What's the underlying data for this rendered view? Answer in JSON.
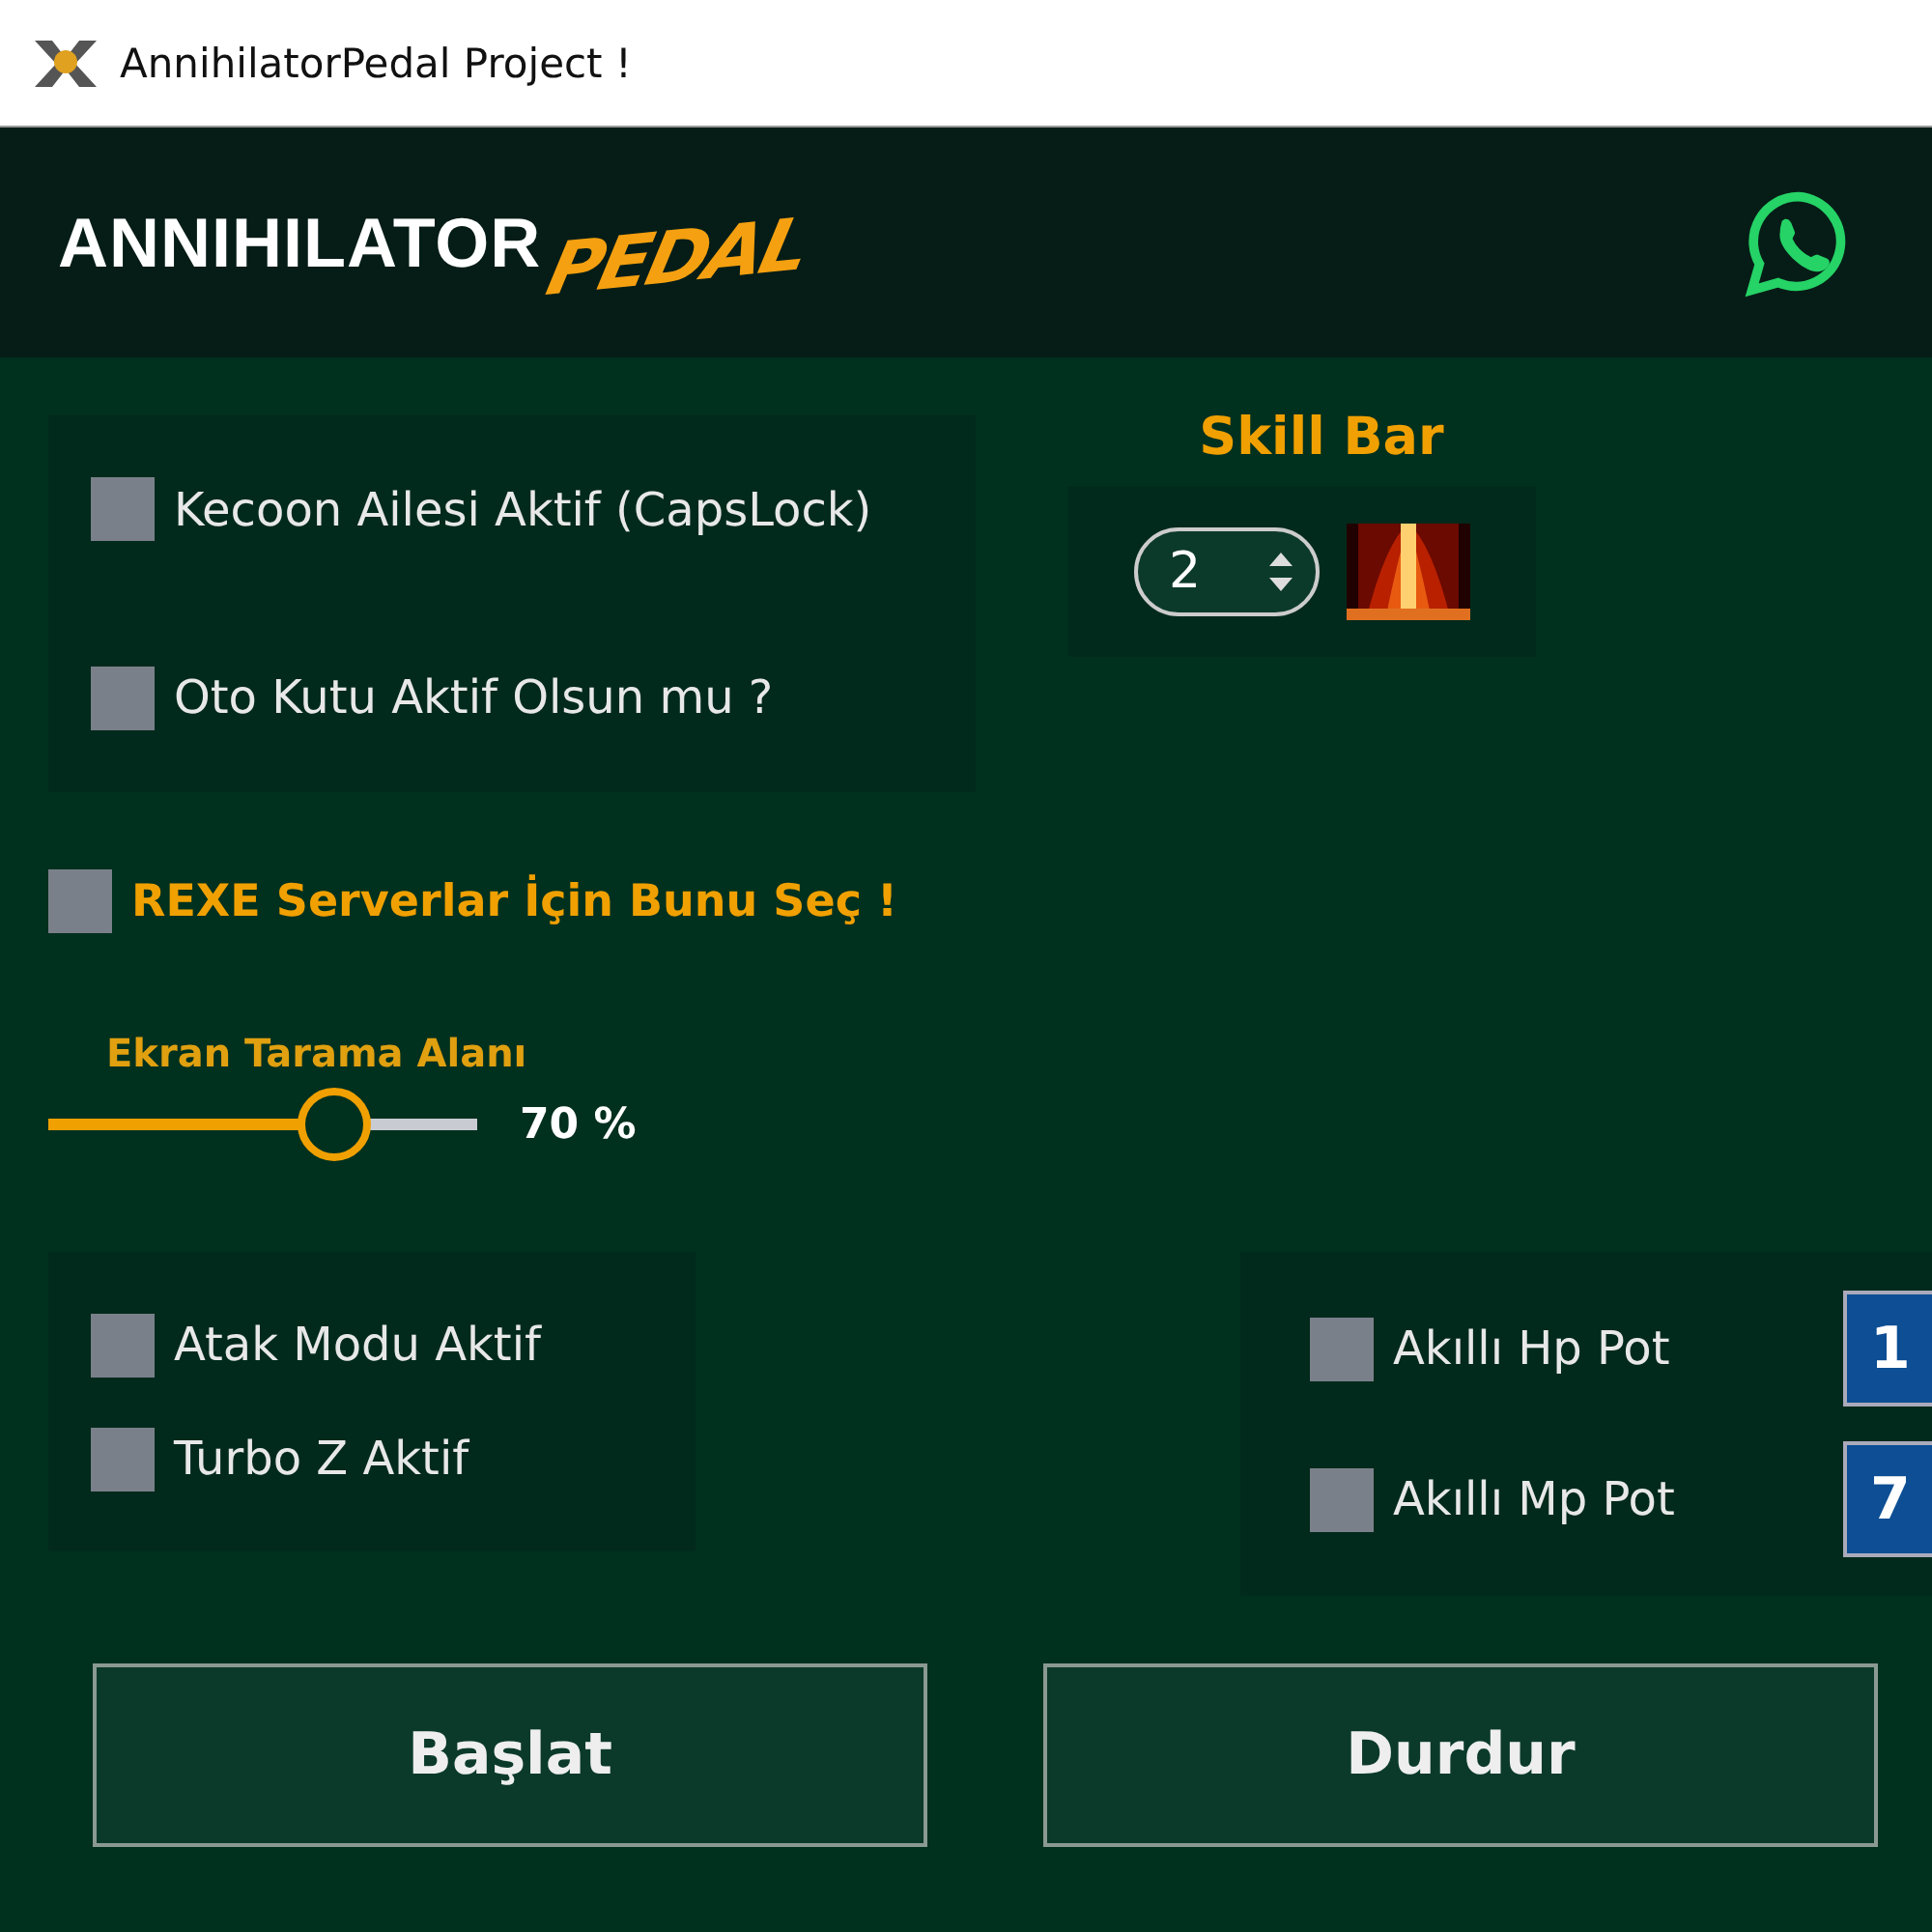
{
  "window": {
    "title": "AnnihilatorPedal Project !"
  },
  "header": {
    "logo_main": "ANNIHILATOR",
    "logo_accent": "PEDAL"
  },
  "options": [
    {
      "label": "Kecoon Ailesi Aktif (CapsLock)",
      "checked": false
    },
    {
      "label": "Oto Kutu Aktif Olsun mu ?",
      "checked": false
    }
  ],
  "skill_bar": {
    "title": "Skill Bar",
    "value": "2"
  },
  "rexe": {
    "label": "REXE Serverlar İçin Bunu Seç !",
    "checked": false
  },
  "scan_area": {
    "label": "Ekran Tarama Alanı",
    "level": 0.66,
    "reading": "70 %"
  },
  "attack_options": [
    {
      "label": "Atak Modu Aktif",
      "checked": false
    },
    {
      "label": "Turbo Z Aktif",
      "checked": false
    }
  ],
  "pots": [
    {
      "label": "Akıllı Hp Pot",
      "checked": false,
      "value": "1"
    },
    {
      "label": "Akıllı Mp Pot",
      "checked": false,
      "value": "7"
    }
  ],
  "buttons": [
    "Başlat",
    "Durdur"
  ]
}
